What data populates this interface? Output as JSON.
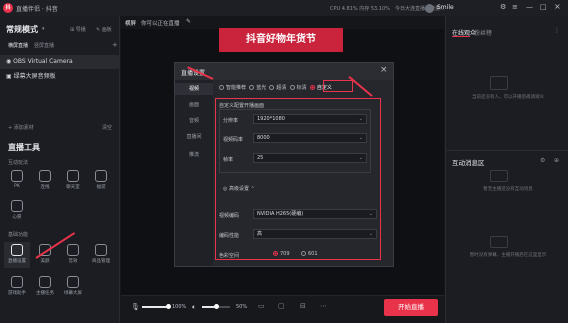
{
  "app": {
    "logo_text": "抖",
    "title": "直播伴侣 · 抖音"
  },
  "titlebar": {
    "status_text": "CPU 4.81% 内存 53.10%",
    "user_name": "Smile",
    "notice": "今日大连直播间流量..."
  },
  "left": {
    "scene_title": "常规模式",
    "scene_tabs": [
      "横屏直播",
      "竖屏直播"
    ],
    "action_labels": [
      "导播",
      "画板"
    ],
    "sources": [
      "OBS Virtual Camera",
      "绿幕大屏音频板"
    ],
    "add_source": "+ 添加素材",
    "clear": "清空",
    "tools_title": "直播工具",
    "group_interact": "互动玩法",
    "tools_row1": [
      "PK",
      "连线",
      "聊天室",
      "福袋"
    ],
    "tools_row2": [
      "心愿"
    ],
    "group_basic": "基础功能",
    "tools_row3": [
      "直播设置",
      "美颜",
      "音效",
      "商品管理"
    ],
    "tools_row4": [
      "游戏助手",
      "主播任务",
      "绿幕大屏"
    ]
  },
  "center": {
    "preview_label": "横屏",
    "preview_caption": "你可以正在直播",
    "banner_text": "抖音好物年货节",
    "volume_mic": "100%",
    "volume_speaker": "50%",
    "start_button": "开始直播"
  },
  "dialog": {
    "title": "直播设置",
    "close": "×",
    "side_items": [
      "视频",
      "画面",
      "音频",
      "直播间",
      "推流"
    ],
    "quality_options": [
      "智能推荐",
      "蓝光",
      "超清",
      "标清",
      "自定义"
    ],
    "quality_selected": 4,
    "custom_title": "自定义配置开播画面",
    "rows": [
      {
        "label": "分辨率",
        "value": "1920*1080"
      },
      {
        "label": "视频码率",
        "value": "8000"
      },
      {
        "label": "帧率",
        "value": "25"
      }
    ],
    "advanced_label": "高级设置",
    "adv_rows": [
      {
        "label": "视频编码",
        "value": "NVIDIA H265(硬编)"
      },
      {
        "label": "编码性能",
        "value": "高"
      }
    ],
    "color_label": "色彩空间",
    "color_options": [
      "709",
      "601"
    ],
    "color_selected": 0
  },
  "right": {
    "tabs": [
      "在线观众",
      "粉丝榜"
    ],
    "empty_audience": "当前还没有人，可以开播后邀请观众",
    "message_title": "互动消息区",
    "empty_message": "暂无主播还没有互动消息",
    "empty_message2": "暂时没有弹幕，主播开播后在这里显示"
  },
  "colors": {
    "accent": "#e8334a",
    "panel": "#1c1d22",
    "bg": "#17181c"
  }
}
